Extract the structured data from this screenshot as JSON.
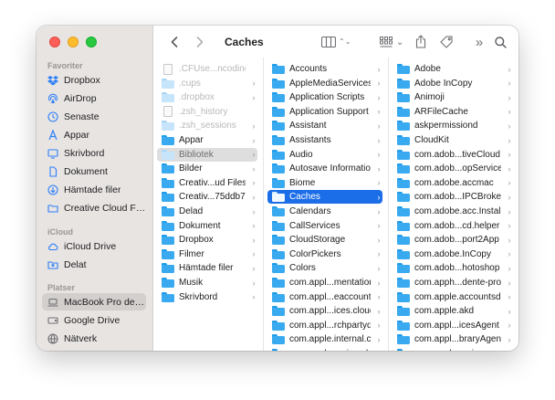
{
  "window": {
    "title": "Caches"
  },
  "sidebar": {
    "sections": [
      {
        "label": "Favoriter"
      },
      {
        "label": "iCloud"
      },
      {
        "label": "Platser"
      }
    ],
    "favorites": [
      {
        "label": "Dropbox",
        "icon": "dropbox-icon"
      },
      {
        "label": "AirDrop",
        "icon": "airdrop-icon"
      },
      {
        "label": "Senaste",
        "icon": "clock-icon"
      },
      {
        "label": "Appar",
        "icon": "apps-icon"
      },
      {
        "label": "Skrivbord",
        "icon": "desktop-icon"
      },
      {
        "label": "Dokument",
        "icon": "document-icon"
      },
      {
        "label": "Hämtade filer",
        "icon": "download-icon"
      },
      {
        "label": "Creative Cloud Files",
        "icon": "creative-cloud-icon"
      }
    ],
    "icloud": [
      {
        "label": "iCloud Drive",
        "icon": "cloud-icon"
      },
      {
        "label": "Delat",
        "icon": "shared-folder-icon"
      }
    ],
    "places": [
      {
        "label": "MacBook Pro de S...",
        "icon": "laptop-icon",
        "selected": true
      },
      {
        "label": "Google Drive",
        "icon": "drive-icon"
      },
      {
        "label": "Nätverk",
        "icon": "network-icon"
      }
    ]
  },
  "toolbar": {
    "back_icon": "chevron-left-icon",
    "forward_icon": "chevron-right-icon",
    "view_icon": "columns-view-icon",
    "group_icon": "grid-icon",
    "share_icon": "share-icon",
    "tag_icon": "tag-icon",
    "more_icon": "more-chevrons-icon",
    "search_icon": "search-icon",
    "view_arrows": "⌃⌄",
    "group_chevron": "⌄",
    "more_glyph": "»"
  },
  "columns": [
    {
      "items": [
        {
          "name": ".CFUse...ncoding",
          "kind": "file",
          "state": "dim"
        },
        {
          "name": ".cups",
          "kind": "folder-light",
          "state": "dim",
          "chevron": true
        },
        {
          "name": ".dropbox",
          "kind": "folder-light",
          "state": "dim",
          "chevron": true
        },
        {
          "name": ".zsh_history",
          "kind": "file",
          "state": "dim"
        },
        {
          "name": ".zsh_sessions",
          "kind": "folder-light",
          "state": "dim",
          "chevron": true
        },
        {
          "name": "Appar",
          "kind": "folder",
          "chevron": true
        },
        {
          "name": "Bibliotek",
          "kind": "folder-light",
          "state": "highlight",
          "chevron": true
        },
        {
          "name": "Bilder",
          "kind": "folder",
          "chevron": true
        },
        {
          "name": "Creativ...ud Files",
          "kind": "folder",
          "chevron": true
        },
        {
          "name": "Creativ...75ddb7",
          "kind": "folder",
          "chevron": true
        },
        {
          "name": "Delad",
          "kind": "folder",
          "chevron": true
        },
        {
          "name": "Dokument",
          "kind": "folder",
          "chevron": true
        },
        {
          "name": "Dropbox",
          "kind": "folder",
          "chevron": true
        },
        {
          "name": "Filmer",
          "kind": "folder",
          "chevron": true
        },
        {
          "name": "Hämtade filer",
          "kind": "folder",
          "chevron": true
        },
        {
          "name": "Musik",
          "kind": "folder",
          "chevron": true
        },
        {
          "name": "Skrivbord",
          "kind": "folder",
          "chevron": true
        }
      ]
    },
    {
      "items": [
        {
          "name": "Accounts",
          "kind": "folder",
          "chevron": true
        },
        {
          "name": "AppleMediaServices",
          "kind": "folder",
          "chevron": true
        },
        {
          "name": "Application Scripts",
          "kind": "folder",
          "chevron": true
        },
        {
          "name": "Application Support",
          "kind": "folder",
          "chevron": true
        },
        {
          "name": "Assistant",
          "kind": "folder",
          "chevron": true
        },
        {
          "name": "Assistants",
          "kind": "folder",
          "chevron": true
        },
        {
          "name": "Audio",
          "kind": "folder",
          "chevron": true
        },
        {
          "name": "Autosave Information",
          "kind": "folder",
          "chevron": true
        },
        {
          "name": "Biome",
          "kind": "folder",
          "chevron": true
        },
        {
          "name": "Caches",
          "kind": "folder-white",
          "state": "selected",
          "chevron": true
        },
        {
          "name": "Calendars",
          "kind": "folder",
          "chevron": true
        },
        {
          "name": "CallServices",
          "kind": "folder",
          "chevron": true
        },
        {
          "name": "CloudStorage",
          "kind": "folder",
          "chevron": true
        },
        {
          "name": "ColorPickers",
          "kind": "folder",
          "chevron": true
        },
        {
          "name": "Colors",
          "kind": "folder",
          "chevron": true
        },
        {
          "name": "com.appl...mentation",
          "kind": "folder",
          "chevron": true
        },
        {
          "name": "com.appl...eaccountd",
          "kind": "folder",
          "chevron": true
        },
        {
          "name": "com.appl...ices.cloud",
          "kind": "folder",
          "chevron": true
        },
        {
          "name": "com.appl...rchpartyd",
          "kind": "folder",
          "chevron": true
        },
        {
          "name": "com.apple.internal.ck",
          "kind": "folder",
          "chevron": true
        },
        {
          "name": "com.appl...ervicesd",
          "kind": "folder",
          "chevron": true
        }
      ]
    },
    {
      "items": [
        {
          "name": "Adobe",
          "kind": "folder",
          "chevron": true
        },
        {
          "name": "Adobe InCopy",
          "kind": "folder",
          "chevron": true
        },
        {
          "name": "Animoji",
          "kind": "folder",
          "chevron": true
        },
        {
          "name": "ARFileCache",
          "kind": "folder",
          "chevron": true
        },
        {
          "name": "askpermissiond",
          "kind": "folder",
          "chevron": true
        },
        {
          "name": "CloudKit",
          "kind": "folder",
          "chevron": true
        },
        {
          "name": "com.adob...tiveCloud",
          "kind": "folder",
          "chevron": true
        },
        {
          "name": "com.adob...opService",
          "kind": "folder",
          "chevron": true
        },
        {
          "name": "com.adobe.accmac",
          "kind": "folder",
          "chevron": true
        },
        {
          "name": "com.adob...IPCBroker",
          "kind": "folder",
          "chevron": true
        },
        {
          "name": "com.adobe.acc.Install",
          "kind": "folder",
          "chevron": true
        },
        {
          "name": "com.adob...cd.helper",
          "kind": "folder",
          "chevron": true
        },
        {
          "name": "com.adob...port2App",
          "kind": "folder",
          "chevron": true
        },
        {
          "name": "com.adobe.InCopy",
          "kind": "folder",
          "chevron": true
        },
        {
          "name": "com.adob...hotoshop",
          "kind": "folder",
          "chevron": true
        },
        {
          "name": "com.apph...dente-pro",
          "kind": "folder",
          "chevron": true
        },
        {
          "name": "com.apple.accountsd",
          "kind": "folder",
          "chevron": true
        },
        {
          "name": "com.apple.akd",
          "kind": "folder",
          "chevron": true
        },
        {
          "name": "com.appl...icesAgent",
          "kind": "folder",
          "chevron": true
        },
        {
          "name": "com.appl...braryAgent",
          "kind": "folder",
          "chevron": true
        },
        {
          "name": "com.appl...ervices",
          "kind": "folder",
          "chevron": true
        }
      ]
    }
  ],
  "chevron_glyph": "›"
}
